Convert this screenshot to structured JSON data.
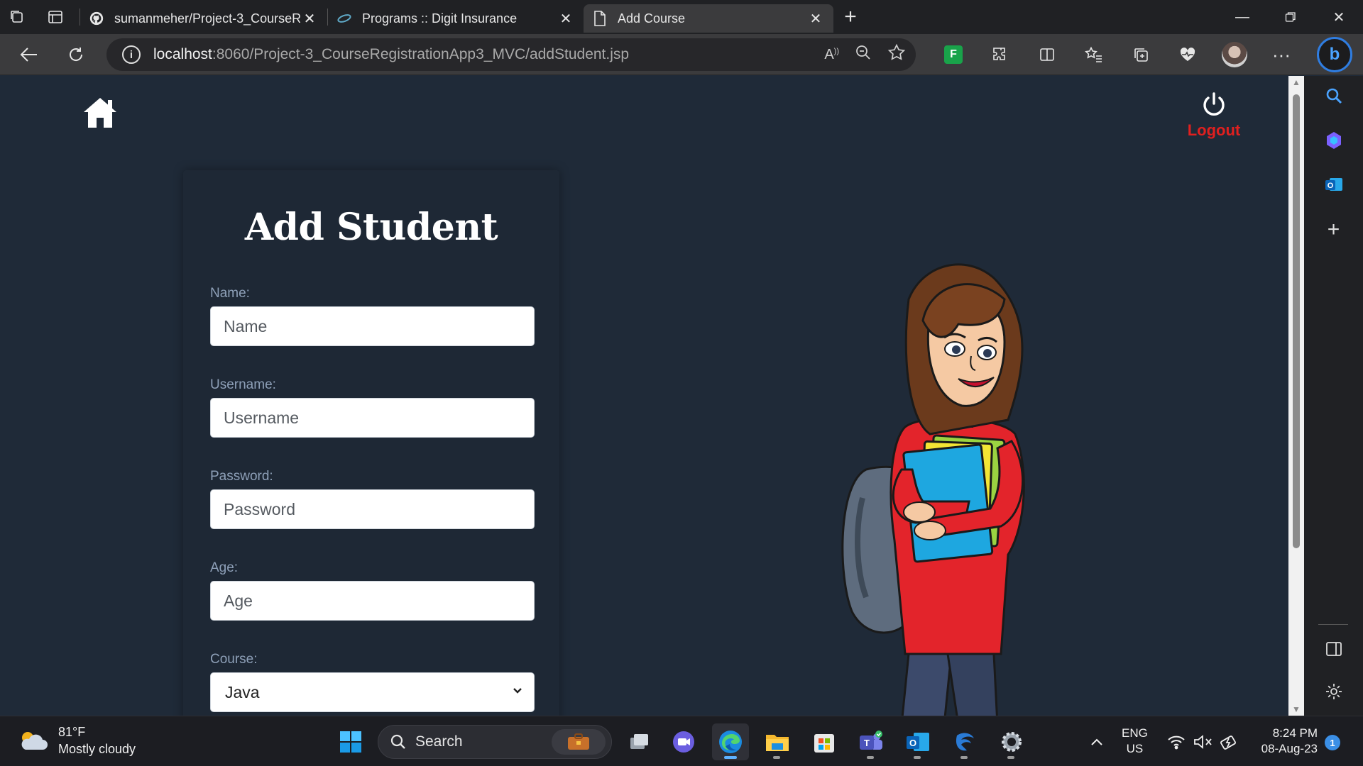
{
  "browser": {
    "tabs": [
      {
        "title": "sumanmeher/Project-3_CourseRe",
        "icon": "github-icon",
        "active": false
      },
      {
        "title": "Programs :: Digit Insurance",
        "icon": "digit-icon",
        "active": false
      },
      {
        "title": "Add Course",
        "icon": "page-icon",
        "active": true
      }
    ],
    "url_host": "localhost",
    "url_rest": ":8060/Project-3_CourseRegistrationApp3_MVC/addStudent.jsp",
    "green_ext_letter": "F"
  },
  "page": {
    "logout_label": "Logout",
    "title": "Add Student",
    "fields": {
      "name": {
        "label": "Name:",
        "placeholder": "Name"
      },
      "username": {
        "label": "Username:",
        "placeholder": "Username"
      },
      "password": {
        "label": "Password:",
        "placeholder": "Password"
      },
      "age": {
        "label": "Age:",
        "placeholder": "Age"
      },
      "course": {
        "label": "Course:",
        "value": "Java"
      }
    }
  },
  "taskbar": {
    "weather_temp": "81°F",
    "weather_desc": "Mostly cloudy",
    "search_label": "Search",
    "lang_line1": "ENG",
    "lang_line2": "US",
    "time": "8:24 PM",
    "date": "08-Aug-23",
    "notification_count": "1"
  },
  "colors": {
    "page_bg": "#1f2a38",
    "logout": "#e0201f",
    "accent": "#3b8fe6"
  }
}
